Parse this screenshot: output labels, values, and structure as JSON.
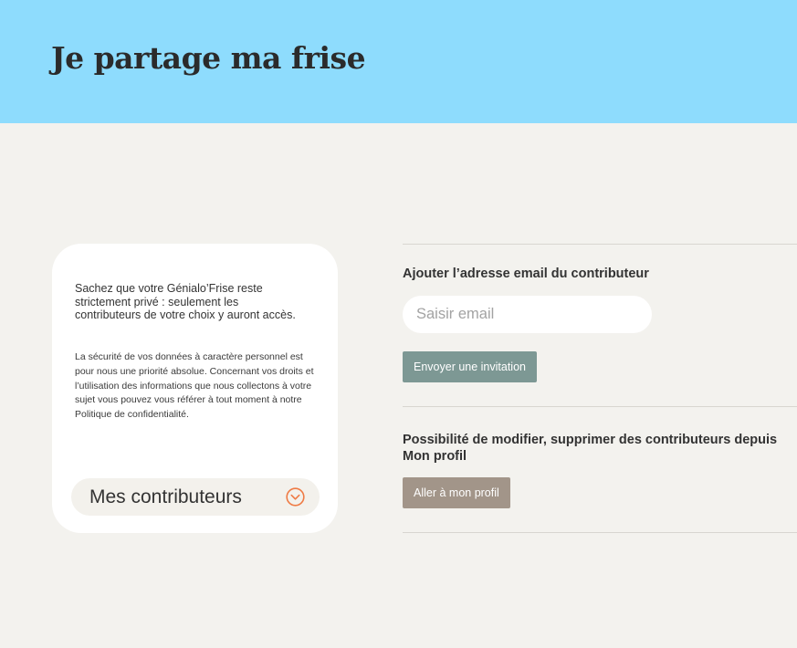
{
  "header": {
    "title": "Je partage ma frise",
    "background": "#8edcfd"
  },
  "info_card": {
    "lead": "Sachez que votre Génialo’Frise reste strictement privé : seulement les contributeurs de votre choix y auront accès.",
    "body": "La sécurité de vos données à caractère personnel est pour nous une priorité absolue. Concernant vos droits et l’utilisation des informations que nous collectons à votre sujet vous pouvez vous référer à tout moment à notre Politique de confidentialité.",
    "contributors_label": "Mes contributeurs",
    "contributors_icon": "chevron-down-circle-icon",
    "accent": "#ef7b45"
  },
  "invite": {
    "title": "Ajouter l’adresse email du contributeur",
    "input_value": "",
    "input_placeholder": "Saisir email",
    "button_label": "Envoyer une invitation",
    "button_color": "#7d9894"
  },
  "manage": {
    "title": "Possibilité de modifier, supprimer des contributeurs depuis Mon profil",
    "button_label": "Aller à mon profil",
    "button_color": "#a29589"
  }
}
